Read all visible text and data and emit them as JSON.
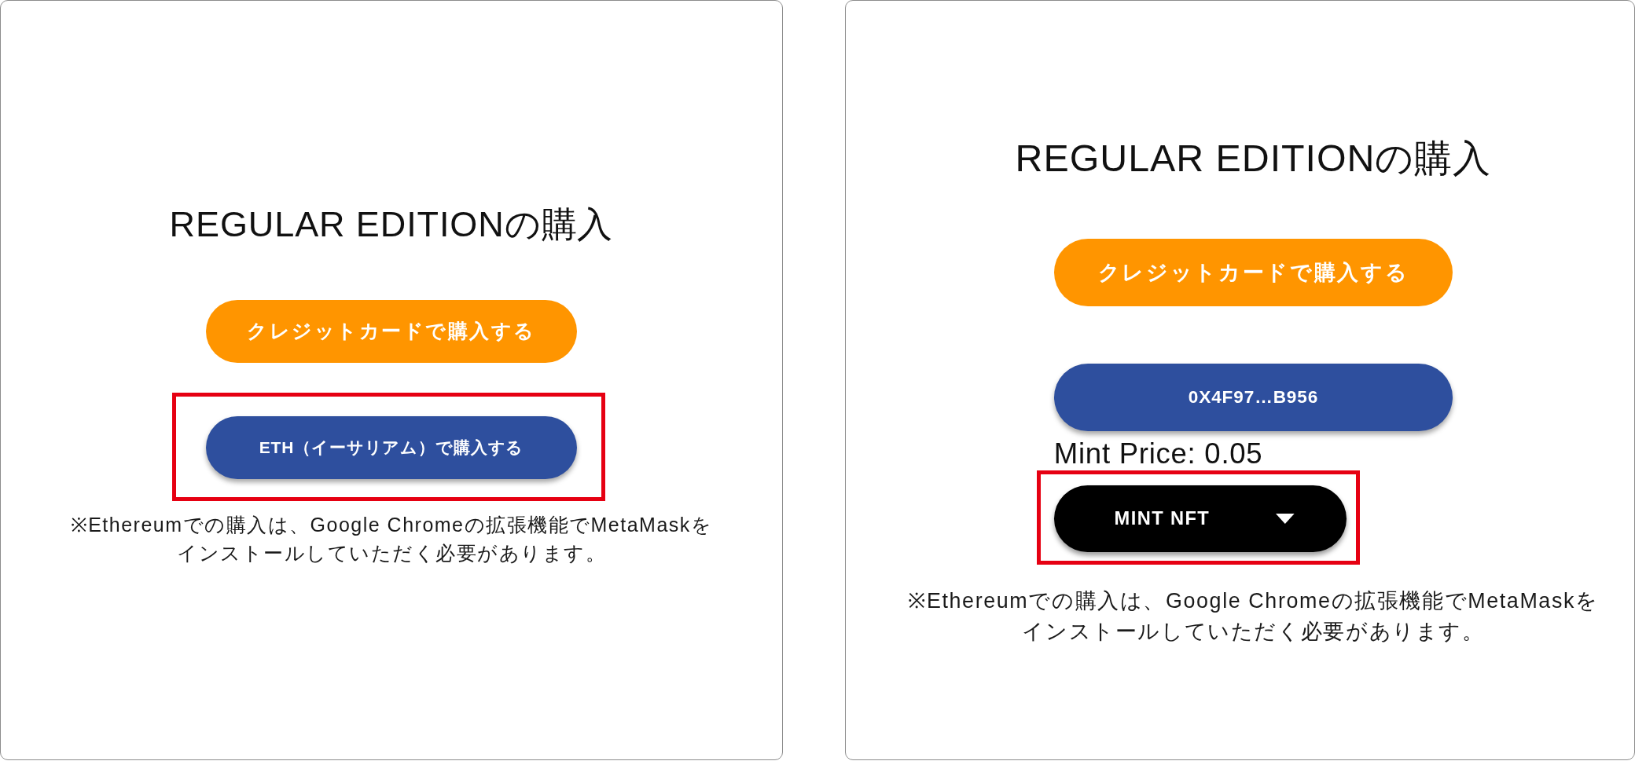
{
  "panels": [
    {
      "title": "REGULAR EDITIONの購入",
      "items": [
        {
          "kind": "card_button",
          "label": "クレジットカードで購入する",
          "highlighted": false
        },
        {
          "kind": "eth_button",
          "label": "ETH（イーサリアム）で購入する",
          "highlighted": true
        }
      ],
      "note": "※Ethereumでの購入は、Google Chromeの拡張機能でMetaMaskをインストールしていただく必要があります。"
    },
    {
      "title": "REGULAR EDITIONの購入",
      "items": [
        {
          "kind": "card_button",
          "label": "クレジットカードで購入する",
          "highlighted": false
        },
        {
          "kind": "wallet_button",
          "label": "0X4F97…B956",
          "highlighted": false
        },
        {
          "kind": "price",
          "label": "Mint Price: 0.05"
        },
        {
          "kind": "mint_button",
          "label": "MINT NFT",
          "highlighted": true
        }
      ],
      "note": "※Ethereumでの購入は、Google Chromeの拡張機能でMetaMaskをインストールしていただく必要があります。"
    }
  ]
}
